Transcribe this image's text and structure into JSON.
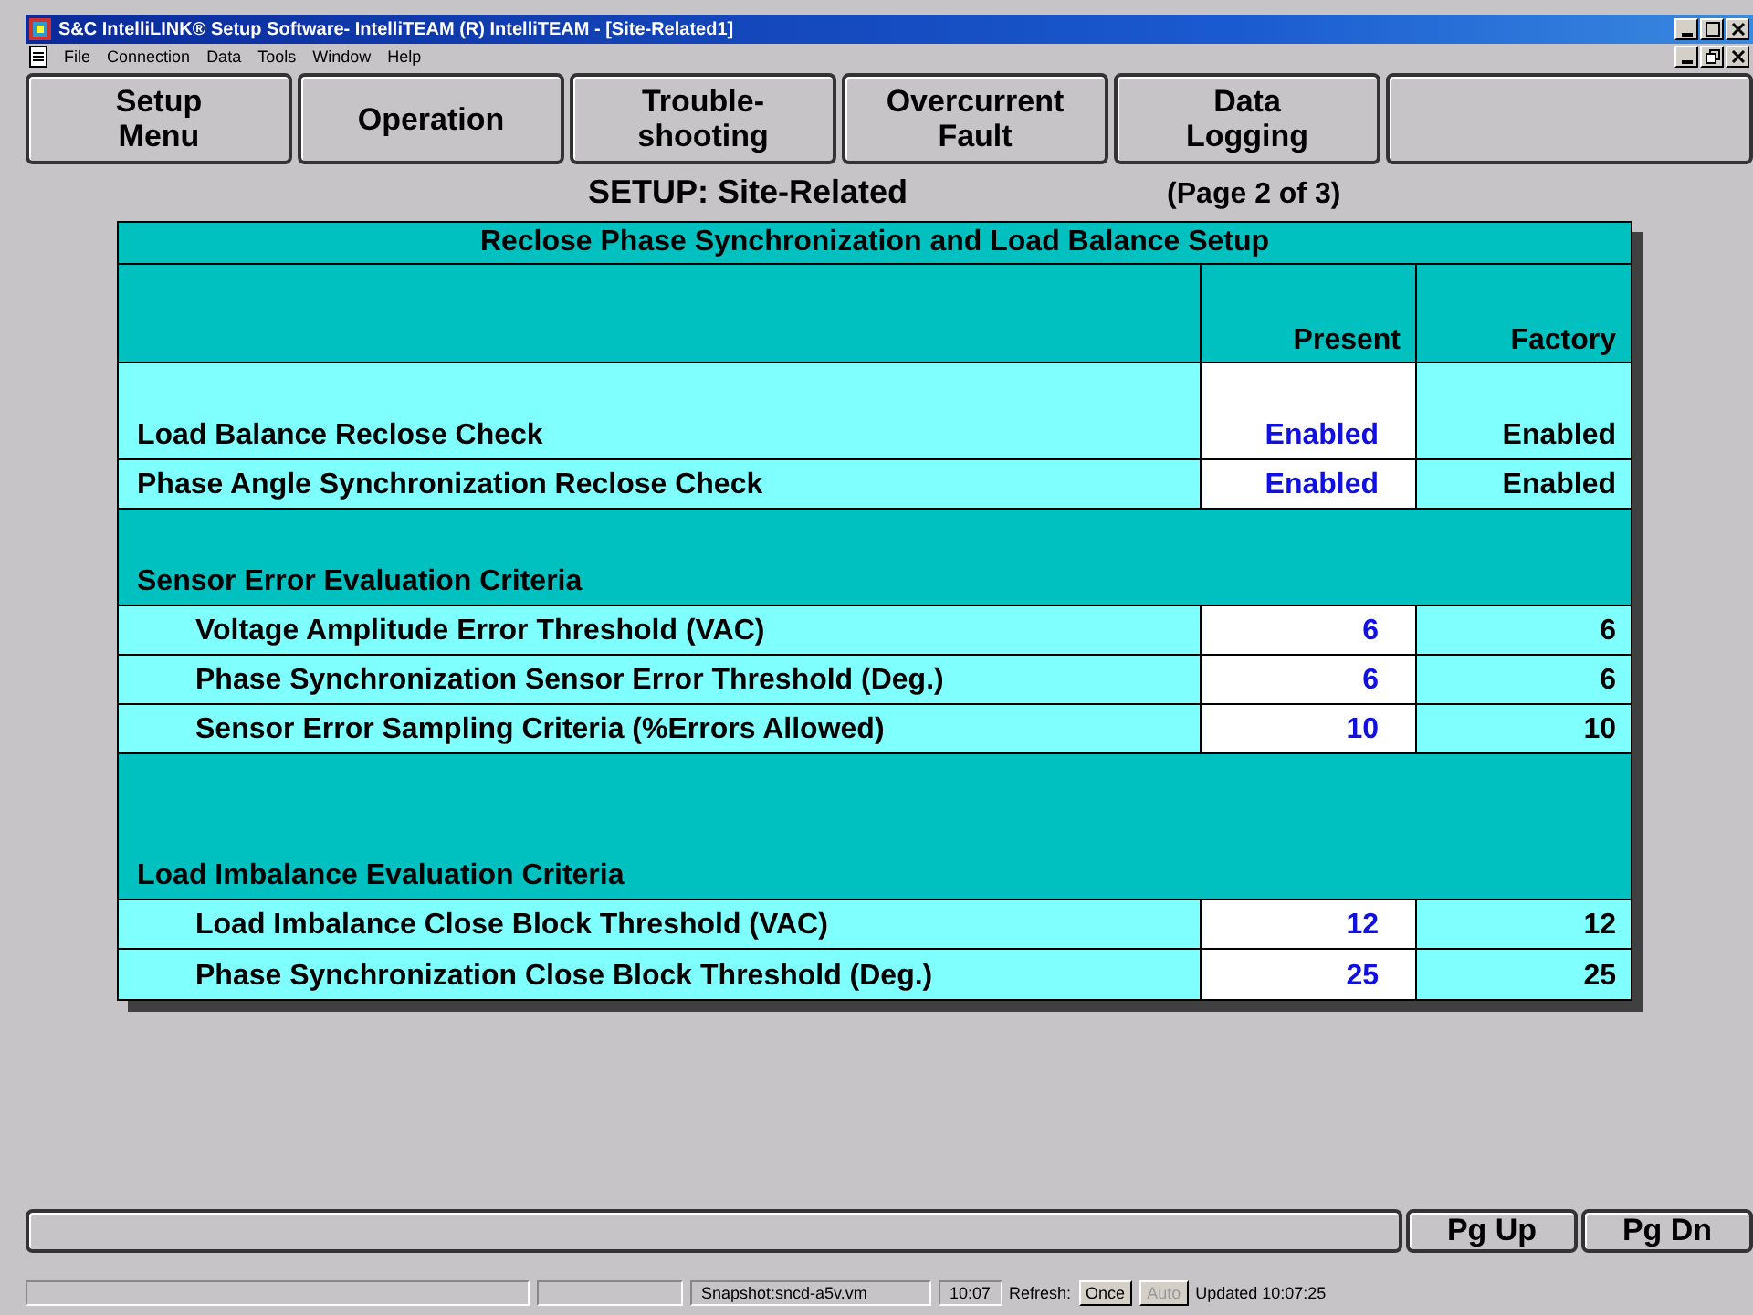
{
  "window": {
    "title": "S&C IntelliLINK® Setup Software- IntelliTEAM (R) IntelliTEAM - [Site-Related1]"
  },
  "menu": [
    "File",
    "Connection",
    "Data",
    "Tools",
    "Window",
    "Help"
  ],
  "nav_buttons": [
    {
      "lines": [
        "Setup",
        "Menu"
      ]
    },
    {
      "lines": [
        "Operation"
      ]
    },
    {
      "lines": [
        "Trouble-",
        "shooting"
      ]
    },
    {
      "lines": [
        "Overcurrent",
        "Fault"
      ]
    },
    {
      "lines": [
        "Data",
        "Logging"
      ]
    },
    {
      "kind": "blank"
    }
  ],
  "page_title": "SETUP: Site-Related",
  "page_number": "(Page 2 of 3)",
  "table": {
    "title": "Reclose Phase Synchronization and Load Balance Setup",
    "columns": [
      "Present",
      "Factory"
    ],
    "rows": [
      {
        "kind": "item",
        "label": "Load Balance Reclose Check",
        "present": "Enabled",
        "factory": "Enabled"
      },
      {
        "kind": "item",
        "label": "Phase Angle Synchronization Reclose Check",
        "present": "Enabled",
        "factory": "Enabled"
      },
      {
        "kind": "section",
        "label": "Sensor Error Evaluation Criteria"
      },
      {
        "kind": "subitem",
        "label": "Voltage Amplitude Error Threshold (VAC)",
        "present": "6",
        "factory": "6"
      },
      {
        "kind": "subitem",
        "label": "Phase Synchronization Sensor Error Threshold (Deg.)",
        "present": "6",
        "factory": "6"
      },
      {
        "kind": "subitem",
        "label": "Sensor Error Sampling Criteria (%Errors Allowed)",
        "present": "10",
        "factory": "10"
      },
      {
        "kind": "section",
        "label": "Load Imbalance Evaluation Criteria"
      },
      {
        "kind": "subitem",
        "label": "Load Imbalance Close Block Threshold (VAC)",
        "present": "12",
        "factory": "12"
      },
      {
        "kind": "subitem",
        "label": "Phase Synchronization Close Block Threshold (Deg.)",
        "present": "25",
        "factory": "25"
      }
    ]
  },
  "page_buttons": [
    "Pg Up",
    "Pg Dn"
  ],
  "status_bar": {
    "snapshot": "Snapshot:sncd-a5v.vm",
    "time": "10:07",
    "refresh_label": "Refresh:",
    "refresh_buttons": [
      {
        "label": "Once",
        "disabled": false
      },
      {
        "label": "Auto",
        "disabled": true
      }
    ],
    "updated": "Updated 10:07:25"
  }
}
